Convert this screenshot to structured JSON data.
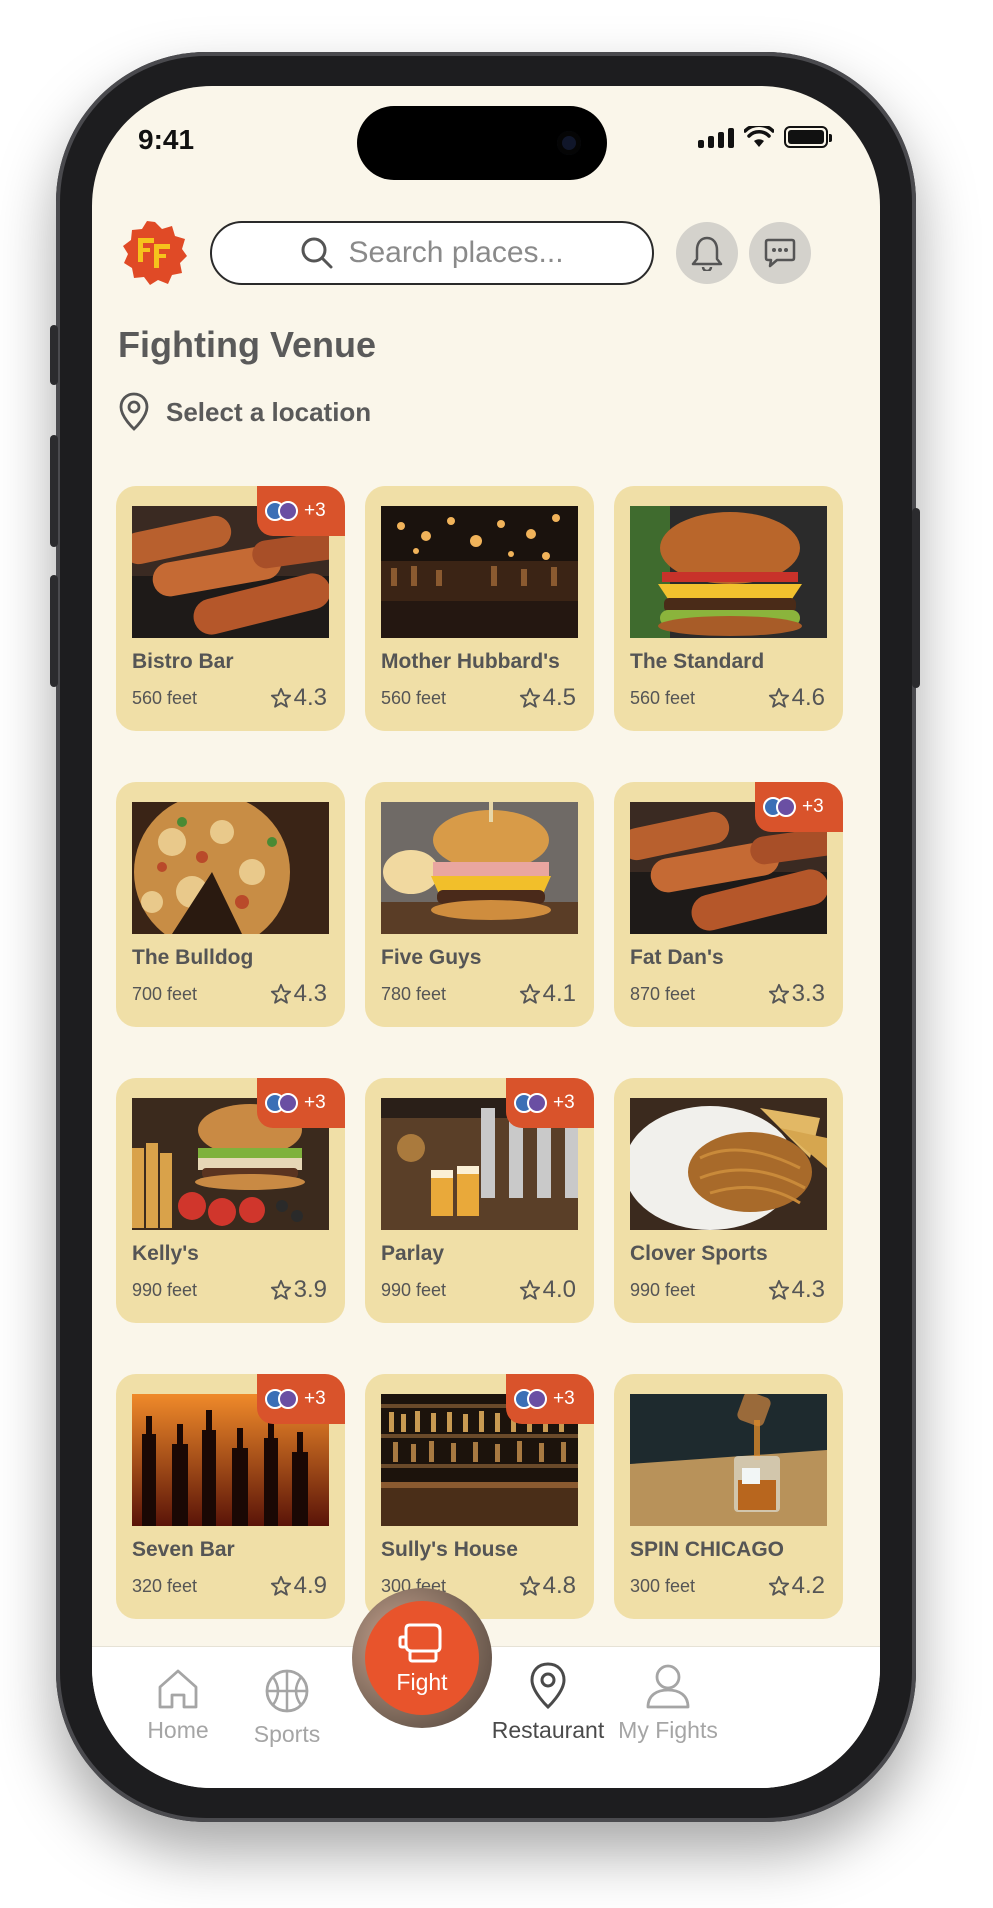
{
  "status_bar": {
    "time": "9:41"
  },
  "header": {
    "logo_icon": "ff-badge-logo",
    "search_placeholder": "Search places...",
    "notification_icon": "bell-icon",
    "message_icon": "chat-bubble-icon"
  },
  "page": {
    "title": "Fighting Venue",
    "location_label": "Select a location"
  },
  "colors": {
    "background": "#faf6ea",
    "card": "#f0dfa7",
    "accent": "#e8542c",
    "badge": "#d9532b"
  },
  "venues": [
    {
      "name": "Bistro Bar",
      "distance": "560 feet",
      "rating": "4.3",
      "badge": "+3",
      "photo": "sausages"
    },
    {
      "name": "Mother Hubbard's",
      "distance": "560 feet",
      "rating": "4.5",
      "badge": "",
      "photo": "bar-interior"
    },
    {
      "name": "The Standard",
      "distance": "560 feet",
      "rating": "4.6",
      "badge": "",
      "photo": "burger"
    },
    {
      "name": "The Bulldog",
      "distance": "700 feet",
      "rating": "4.3",
      "badge": "",
      "photo": "pizza"
    },
    {
      "name": "Five Guys",
      "distance": "780 feet",
      "rating": "4.1",
      "badge": "",
      "photo": "cheeseburger"
    },
    {
      "name": "Fat Dan's",
      "distance": "870 feet",
      "rating": "3.3",
      "badge": "+3",
      "photo": "sausages"
    },
    {
      "name": "Kelly's",
      "distance": "990 feet",
      "rating": "3.9",
      "badge": "+3",
      "photo": "burger-plate"
    },
    {
      "name": "Parlay",
      "distance": "990 feet",
      "rating": "4.0",
      "badge": "+3",
      "photo": "beer-taps"
    },
    {
      "name": "Clover Sports",
      "distance": "990 feet",
      "rating": "4.3",
      "badge": "",
      "photo": "pasta"
    },
    {
      "name": "Seven Bar",
      "distance": "320 feet",
      "rating": "4.9",
      "badge": "+3",
      "photo": "bottles"
    },
    {
      "name": "Sully's House",
      "distance": "300 feet",
      "rating": "4.8",
      "badge": "+3",
      "photo": "bar-shelves"
    },
    {
      "name": "SPIN CHICAGO",
      "distance": "300 feet",
      "rating": "4.2",
      "badge": "",
      "photo": "whiskey-pour"
    }
  ],
  "nav": {
    "home": "Home",
    "sports": "Sports",
    "fight": "Fight",
    "restaurant": "Restaurant",
    "my_fights": "My Fights",
    "active": "restaurant"
  }
}
